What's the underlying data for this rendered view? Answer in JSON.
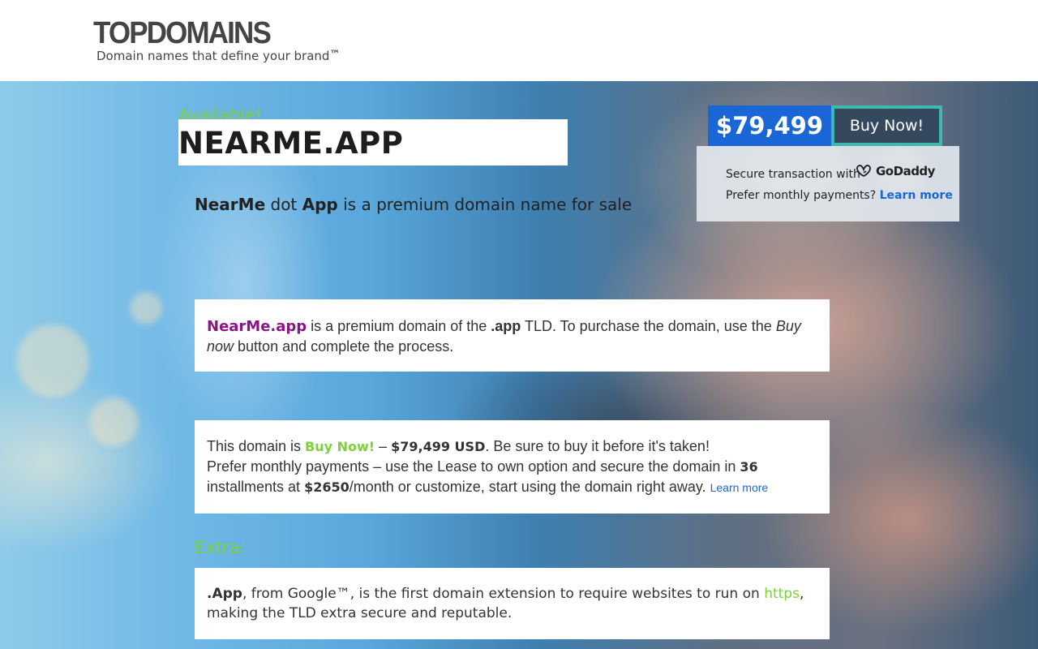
{
  "header": {
    "logo": "TOPDOMAINS",
    "tagline": "Domain names that define your brand",
    "tagline_mark": "™"
  },
  "hero": {
    "available_label": "Available!",
    "domain_name": "NEARME.APP",
    "subtitle": {
      "part1": "NearMe",
      "part2": " dot ",
      "part3": "App",
      "part4": " is a premium domain name for sale"
    }
  },
  "purchase": {
    "price": "$79,499",
    "buy_label": "Buy Now!",
    "secure_text": "Secure transaction with",
    "brand": "GoDaddy",
    "monthly_text": "Prefer monthly payments? ",
    "monthly_link": "Learn more"
  },
  "card1": {
    "domain": "NearMe.app",
    "t1": " is a premium domain of the ",
    "tld": ".app",
    "t2": " TLD. To purchase the domain, use the ",
    "buy_now": "Buy now",
    "t3": " button and complete the process."
  },
  "card2": {
    "t1": "This domain is ",
    "status": "Buy Now!",
    "t2": " – ",
    "price": "$79,499 USD",
    "t3": ". Be sure to buy it before it's taken!",
    "t4": "Prefer monthly payments – use the Lease to own option and secure the domain in ",
    "installments": "36",
    "t5": " installments at ",
    "monthly": "$2650",
    "t6": "/month or customize, start using the domain right away. ",
    "link": "Learn more"
  },
  "extra": {
    "label": "Extra:",
    "tld": ".App",
    "t1": ", from ",
    "google": "Google™",
    "t2": ", is the first domain extension to require websites to run on ",
    "https": "https",
    "t3": ", making the TLD extra secure and reputable."
  },
  "colors": {
    "accent_green": "#7dd13b",
    "price_blue": "#1a66d6",
    "button_dark": "#34495e",
    "button_border": "#3fb8ae",
    "domain_purple": "#8a1487"
  }
}
